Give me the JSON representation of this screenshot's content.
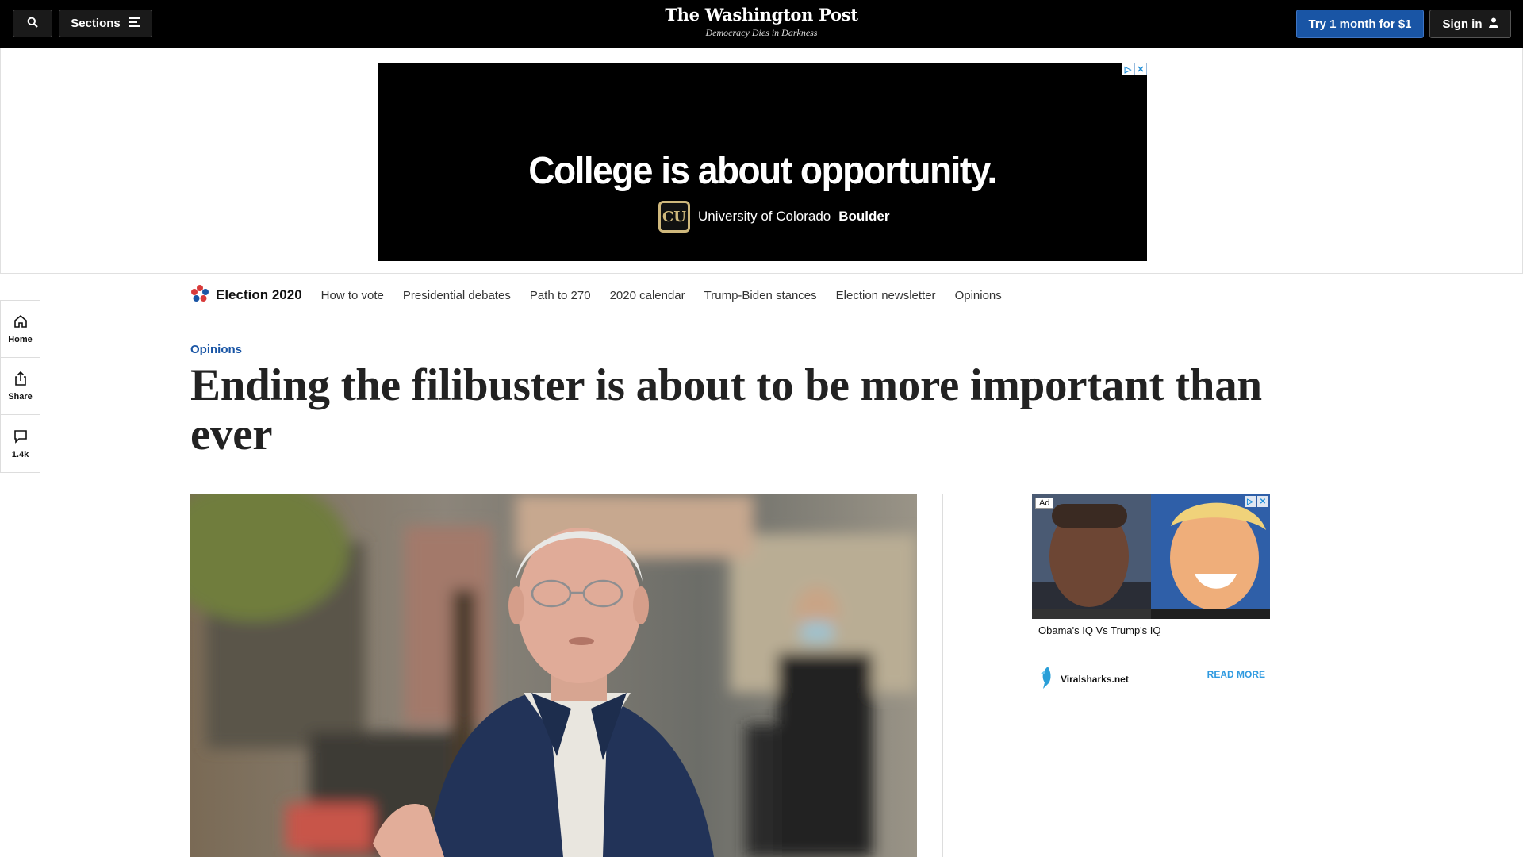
{
  "topnav": {
    "search_icon": "search-icon",
    "sections_label": "Sections",
    "menu_icon": "hamburger-icon",
    "logo_name": "The Washington Post",
    "logo_tagline": "Democracy Dies in Darkness",
    "subscribe_label": "Try 1 month for $1",
    "signin_label": "Sign in",
    "user_icon": "user-icon",
    "accent_color": "#1955a5"
  },
  "top_ad": {
    "headline": "College is about opportunity.",
    "brand_logo_text": "CU",
    "brand_prefix": "University of Colorado",
    "brand_suffix": "Boulder"
  },
  "left_rail": {
    "items": [
      {
        "label": "Home",
        "icon": "home-icon"
      },
      {
        "label": "Share",
        "icon": "share-icon"
      },
      {
        "label": "1.4k",
        "icon": "comment-icon"
      }
    ]
  },
  "election_bar": {
    "title": "Election 2020",
    "links": [
      "How to vote",
      "Presidential debates",
      "Path to 270",
      "2020 calendar",
      "Trump-Biden stances",
      "Election newsletter",
      "Opinions"
    ]
  },
  "article": {
    "kicker": "Opinions",
    "headline": "Ending the filibuster is about to be more important than ever"
  },
  "side_ad": {
    "ad_label": "Ad",
    "caption": "Obama's IQ Vs Trump's IQ",
    "source": "Viralsharks.net",
    "cta": "READ MORE"
  }
}
